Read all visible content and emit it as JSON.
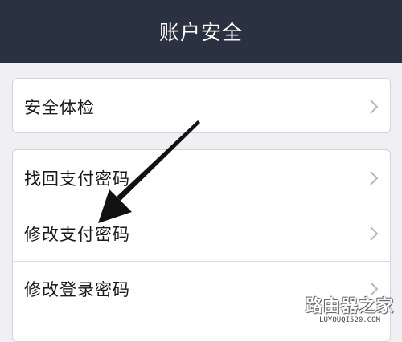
{
  "header": {
    "title": "账户安全"
  },
  "groups": [
    {
      "items": [
        {
          "label": "安全体检"
        }
      ]
    },
    {
      "items": [
        {
          "label": "找回支付密码"
        },
        {
          "label": "修改支付密码"
        },
        {
          "label": "修改登录密码"
        }
      ]
    }
  ],
  "watermark": {
    "site_name": "路由器之家",
    "site_url": "LUYOUQI520.COM"
  },
  "colors": {
    "header_bg": "#2a3140",
    "page_bg": "#efeff4",
    "chevron": "#b8b8bc",
    "arrow": "#111111"
  }
}
